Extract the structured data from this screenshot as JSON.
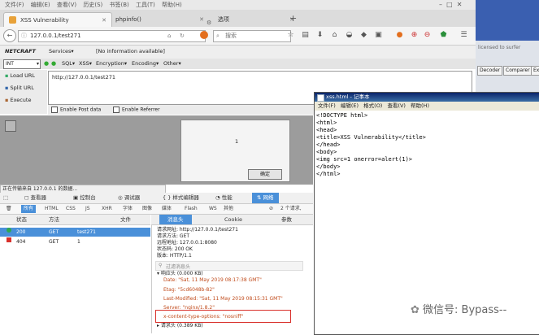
{
  "menubar": {
    "items": [
      "文件(F)",
      "编辑(E)",
      "查看(V)",
      "历史(S)",
      "书签(B)",
      "工具(T)",
      "帮助(H)"
    ]
  },
  "tabs": [
    {
      "label": "XSS Vulnerability",
      "active": true
    },
    {
      "label": "phpinfo()",
      "active": false
    },
    {
      "label": "选项",
      "active": false
    }
  ],
  "nav": {
    "url": "127.0.0.1/test271",
    "search_placeholder": "搜索"
  },
  "netcraft": {
    "brand": "NETCRAFT",
    "services": "Services▾",
    "info": "[No information available]"
  },
  "hackbar": {
    "select": "INT",
    "items": [
      "SQL▾",
      "XSS▾",
      "Encryption▾",
      "Encoding▾",
      "Other▾"
    ]
  },
  "hackside": {
    "load": "Load URL",
    "split": "Split URL",
    "execute": "Execute"
  },
  "hackurl": {
    "value": "http://127.0.0.1/test271"
  },
  "hackopts": {
    "post": "Enable Post data",
    "referrer": "Enable Referrer"
  },
  "alert": {
    "message": "1",
    "ok": "确定"
  },
  "statusline": "正在传输来自 127.0.0.1 的数据...",
  "devtools": {
    "tabs": [
      "查看器",
      "控制台",
      "调试器",
      "样式编辑器",
      "性能",
      "网络"
    ],
    "filters": [
      "所有",
      "HTML",
      "CSS",
      "JS",
      "XHR",
      "字体",
      "图像",
      "媒体",
      "Flash",
      "WS",
      "其他"
    ],
    "count": "2 个请求,",
    "columns": {
      "status": "状态",
      "method": "方法",
      "file": "文件"
    },
    "requests": [
      {
        "status": "200",
        "method": "GET",
        "file": "test271",
        "color": "#2fa84f"
      },
      {
        "status": "404",
        "method": "GET",
        "file": "1",
        "color": "#d9302b"
      }
    ],
    "detail_tabs": [
      "消息头",
      "Cookie",
      "参数"
    ],
    "summary": [
      "请求网址: http://127.0.0.1/test271",
      "请求方法: GET",
      "远程地址: 127.0.0.1:8080",
      "状态码: 200 OK",
      "版本: HTTP/1.1"
    ],
    "filter_label": "过滤消息头",
    "response_section": "响应头 (0.000 KB)",
    "headers": [
      {
        "name": "Date:",
        "value": "\"Sat, 11 May 2019 08:17:38 GMT\""
      },
      {
        "name": "Etag:",
        "value": "\"5cd6048b-82\""
      },
      {
        "name": "Last-Modified:",
        "value": "\"Sat, 11 May 2019 08:15:31 GMT\""
      },
      {
        "name": "Server:",
        "value": "\"nginx/1.8.2\""
      },
      {
        "name": "x-content-type-options:",
        "value": "\"nosniff\""
      }
    ],
    "request_section": "请求头 (0.389 KB)"
  },
  "notepad": {
    "title": "xss.html - 记事本",
    "menu": [
      "文件(F)",
      "编辑(E)",
      "格式(O)",
      "查看(V)",
      "帮助(H)"
    ],
    "lines": [
      "<!DOCTYPE html>",
      "<html>",
      "<head>",
      "<title>XSS Vulnerability</title>",
      "</head>",
      "<body>",
      "<img src=1 onerror=alert(1)>",
      "</body>",
      "</html>"
    ]
  },
  "right_panel": {
    "banner": "licensed to surfer",
    "buttons": [
      "Decoder",
      "Comparer",
      "Ex"
    ]
  },
  "watermark": "微信号: Bypass--",
  "colors": {
    "accent": "#4a90d9",
    "ok": "#2fa84f",
    "error": "#d9302b",
    "highlight": "#d9302b"
  }
}
